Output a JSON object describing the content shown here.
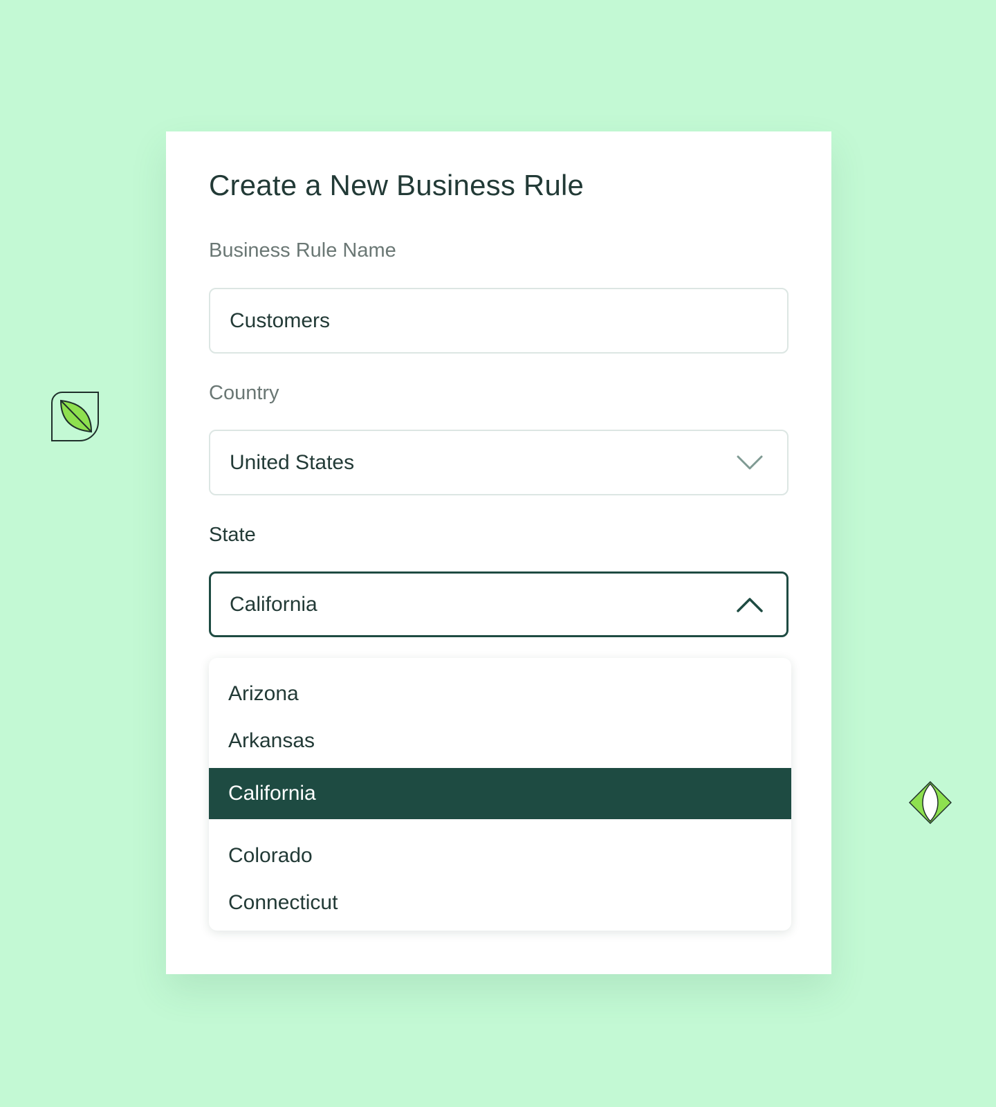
{
  "form": {
    "title": "Create a New Business Rule",
    "name_label": "Business Rule Name",
    "name_value": "Customers",
    "country_label": "Country",
    "country_value": "United States",
    "state_label": "State",
    "state_value": "California"
  },
  "state_dropdown": {
    "options": [
      "Arizona",
      "Arkansas",
      "California",
      "Colorado",
      "Connecticut"
    ],
    "selected": "California"
  },
  "colors": {
    "background": "#c3f9d4",
    "accent_dark_green": "#1e4b42",
    "leaf_green": "#8ee04f"
  },
  "icons": {
    "country_select": "chevron-down-icon",
    "state_select": "chevron-up-icon",
    "decoration_left": "leaf-icon",
    "decoration_right": "diamond-icon"
  }
}
